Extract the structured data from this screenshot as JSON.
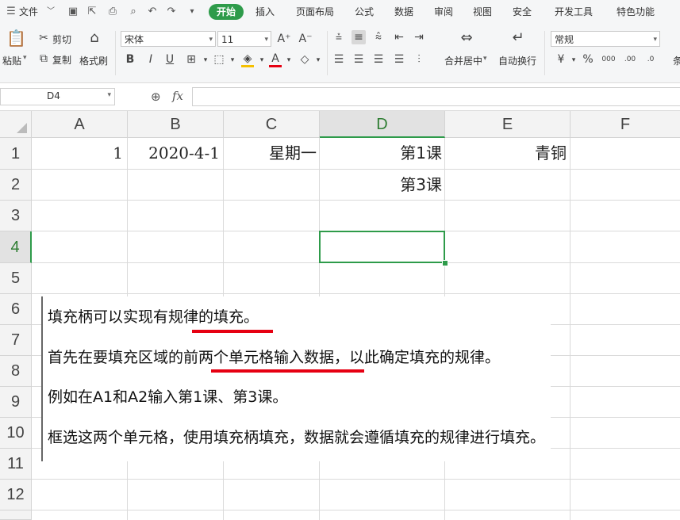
{
  "menubar": {
    "file_label": "文件",
    "tabs": [
      "开始",
      "插入",
      "页面布局",
      "公式",
      "数据",
      "审阅",
      "视图",
      "安全",
      "开发工具",
      "特色功能"
    ],
    "active_tab": "开始"
  },
  "ribbon": {
    "paste_label": "粘贴",
    "cut_label": "剪切",
    "copy_label": "复制",
    "format_painter_label": "格式刷",
    "font_name": "宋体",
    "font_size": "11",
    "merge_label": "合并居中",
    "wrap_label": "自动换行",
    "number_format": "常规",
    "extra_label": "条"
  },
  "formula_bar": {
    "name_box": "D4",
    "fx_label": "fx",
    "content": ""
  },
  "sheet": {
    "columns": [
      "A",
      "B",
      "C",
      "D",
      "E",
      "F"
    ],
    "rows": [
      "1",
      "2",
      "3",
      "4",
      "5",
      "6",
      "7",
      "8",
      "9",
      "10",
      "11",
      "12"
    ],
    "selected_cell": "D4",
    "cells": {
      "A1": "1",
      "B1": "2020-4-1",
      "C1": "星期一",
      "D1": "第1课",
      "E1": "青铜",
      "D2": "第3课"
    }
  },
  "note": {
    "lines": [
      "填充柄可以实现有规律的填充。",
      "首先在要填充区域的前两个单元格输入数据，以此确定填充的规律。",
      "例如在A1和A2输入第1课、第3课。",
      "框选这两个单元格，使用填充柄填充，数据就会遵循填充的规律进行填充。"
    ]
  },
  "colors": {
    "active_tab_bg": "#2e9b4a",
    "selection_border": "#2e9b4a",
    "underline_red": "#e60012"
  }
}
